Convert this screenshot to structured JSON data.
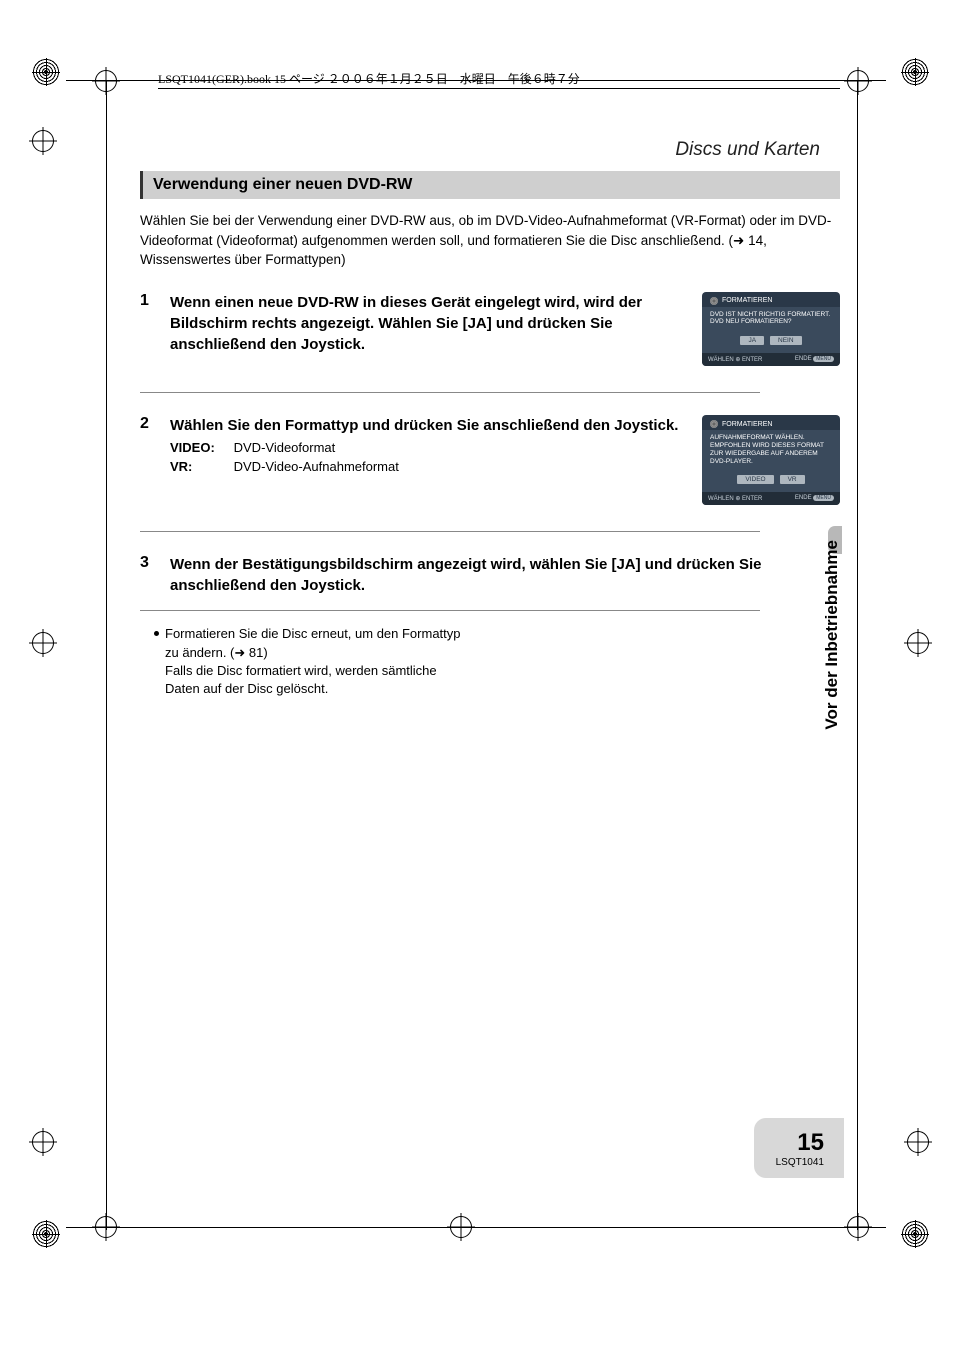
{
  "header_line": "LSQT1041(GER).book  15 ページ  ２００６年１月２５日　水曜日　午後６時７分",
  "breadcrumb": "Discs und Karten",
  "section_heading": "Verwendung einer neuen DVD-RW",
  "intro": "Wählen Sie bei der Verwendung einer DVD-RW aus, ob im DVD-Video-Aufnahmeformat (VR-Format) oder im DVD-Videoformat (Videoformat) aufgenommen werden soll, und formatieren Sie die Disc anschließend. (➜ 14, Wissenswertes über Formattypen)",
  "steps": {
    "s1": {
      "num": "1",
      "text": "Wenn einen neue DVD-RW in dieses Gerät eingelegt wird, wird der Bildschirm rechts angezeigt. Wählen Sie [JA] und drücken Sie anschließend den Joystick."
    },
    "s2": {
      "num": "2",
      "text": "Wählen Sie den Formattyp und drücken Sie anschließend den Joystick.",
      "video_lbl": "VIDEO:",
      "video_val": "DVD-Videoformat",
      "vr_lbl": "VR:",
      "vr_val": "DVD-Video-Aufnahmeformat"
    },
    "s3": {
      "num": "3",
      "text": "Wenn der Bestätigungsbildschirm angezeigt wird, wählen Sie [JA] und drücken Sie anschließend den Joystick."
    }
  },
  "notes": {
    "n1a": "Formatieren Sie die Disc erneut, um den Formattyp zu ändern. (➜ 81)",
    "n1b": "Falls die Disc formatiert wird, werden sämtliche Daten auf der Disc gelöscht."
  },
  "screen1": {
    "title": "FORMATIEREN",
    "body": "DVD IST NICHT RICHTIG FORMATIERT. DVD NEU FORMATIEREN?",
    "btn1": "JA",
    "btn2": "NEIN",
    "foot_l": "WÄHLEN ⊕ ENTER",
    "foot_r": "ENDE",
    "foot_badge": "MENU"
  },
  "screen2": {
    "title": "FORMATIEREN",
    "body": "AUFNAHMEFORMAT WÄHLEN. EMPFOHLEN WIRD DIESES FORMAT ZUR WIEDERGABE AUF ANDEREM DVD-PLAYER.",
    "btn1": "VIDEO",
    "btn2": "VR",
    "foot_l": "WÄHLEN ⊕ ENTER",
    "foot_r": "ENDE",
    "foot_badge": "MENU"
  },
  "side_tab": "Vor der Inbetriebnahme",
  "page_number": "15",
  "doc_code": "LSQT1041"
}
